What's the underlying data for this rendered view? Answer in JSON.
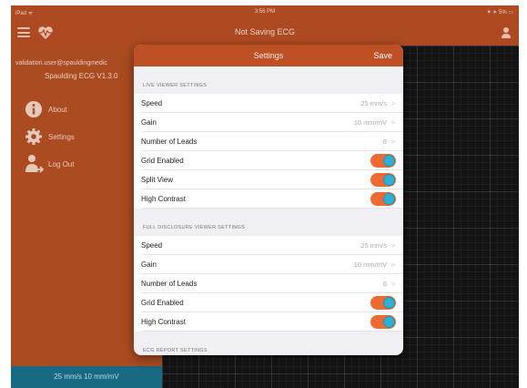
{
  "status_bar": {
    "carrier": "iPad ᯤ",
    "time": "3:56 PM",
    "battery": "⁕ ∗ 5% ▭"
  },
  "nav_bar": {
    "title": "Not Saving ECG"
  },
  "sidebar": {
    "user": "validation.user@spauldingmedic",
    "version": "Spaulding ECG V1.3.0",
    "items": [
      {
        "label": "About",
        "icon": "info-icon"
      },
      {
        "label": "Settings",
        "icon": "gear-icon"
      },
      {
        "label": "Log Out",
        "icon": "person-logout-icon"
      }
    ],
    "speed_bar": "25 mm/s 10 mm/mV"
  },
  "modal": {
    "title": "Settings",
    "save_label": "Save",
    "live_section": {
      "header": "LIVE VIEWER SETTINGS",
      "speed": {
        "label": "Speed",
        "value": "25 mm/s"
      },
      "gain": {
        "label": "Gain",
        "value": "10 mm/mV"
      },
      "leads": {
        "label": "Number of Leads",
        "value": "6"
      },
      "grid": {
        "label": "Grid Enabled",
        "on": true
      },
      "split": {
        "label": "Split View",
        "on": true
      },
      "contrast": {
        "label": "High Contrast",
        "on": true
      }
    },
    "full_section": {
      "header": "FULL DISCLOSURE VIEWER SETTINGS",
      "speed": {
        "label": "Speed",
        "value": "25 mm/s"
      },
      "gain": {
        "label": "Gain",
        "value": "10 mm/mV"
      },
      "leads": {
        "label": "Number of Leads",
        "value": "6"
      },
      "grid": {
        "label": "Grid Enabled",
        "on": true
      },
      "contrast": {
        "label": "High Contrast",
        "on": true
      }
    },
    "report_section": {
      "header": "ECG REPORT SETTINGS"
    }
  },
  "colors": {
    "brand_orange": "#b84f24",
    "toggle_on": "#ef6a33",
    "toggle_knob": "#2fb0d2",
    "speed_bar": "#1a6f8a"
  }
}
